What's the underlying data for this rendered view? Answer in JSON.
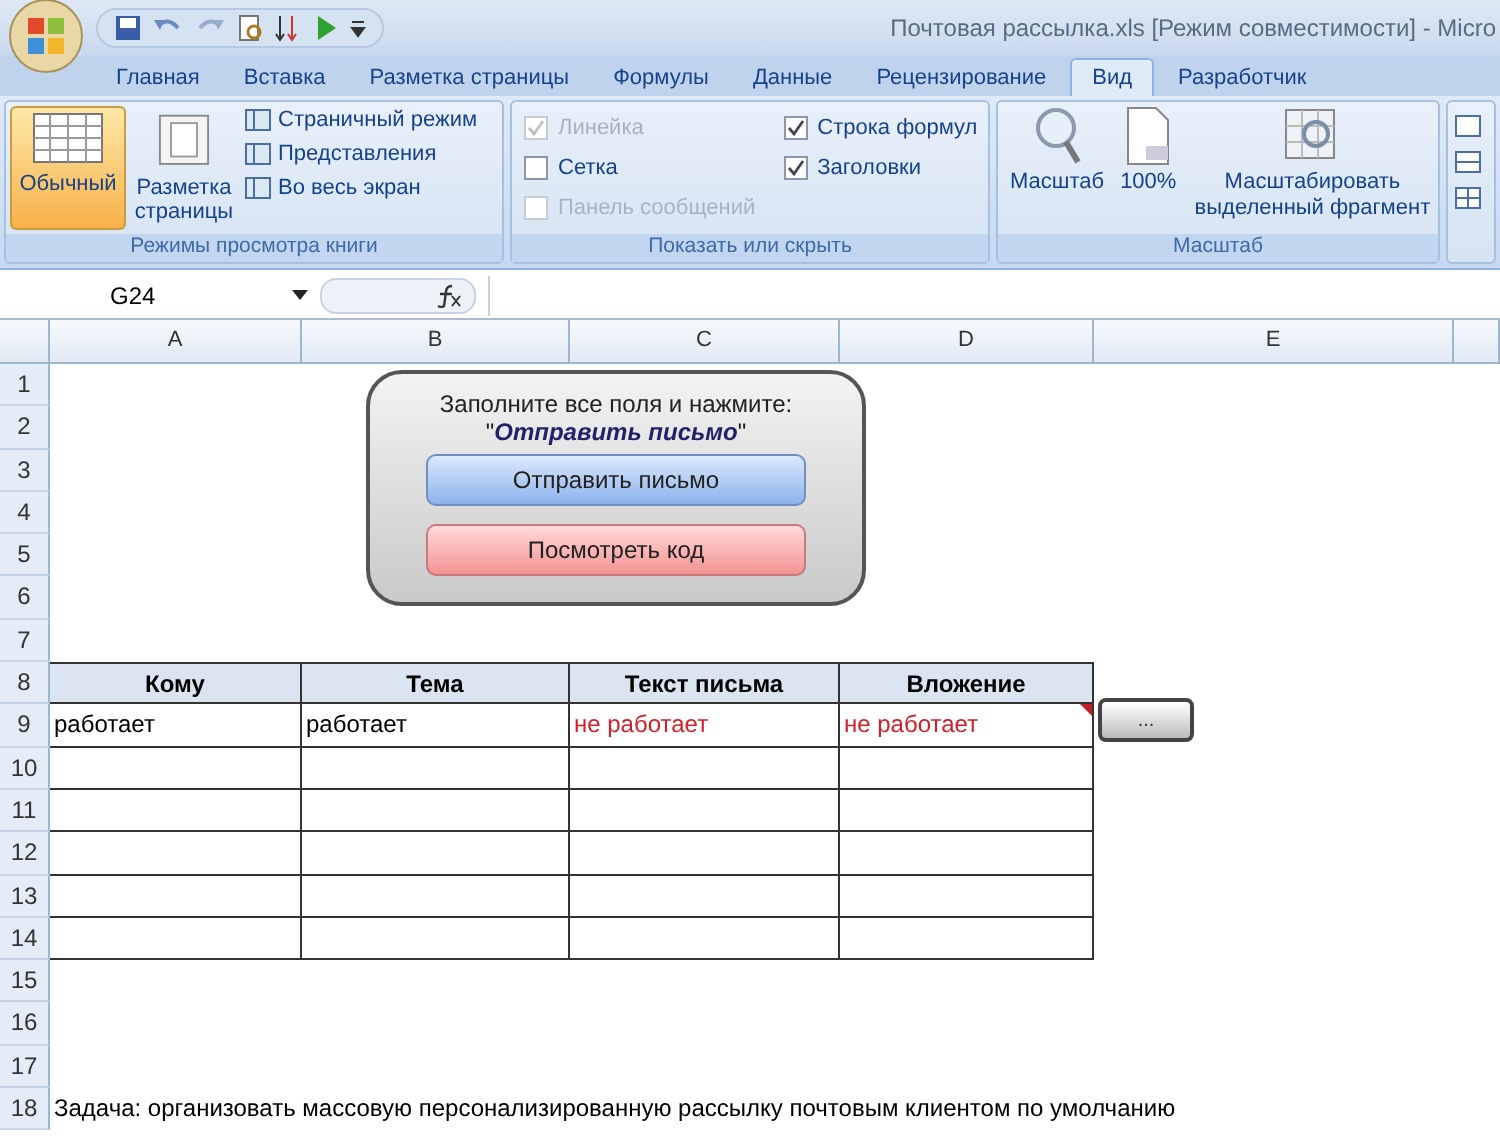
{
  "window": {
    "title": "Почтовая рассылка.xls  [Режим совместимости] - Micro"
  },
  "tabs": [
    {
      "label": "Главная",
      "selected": false
    },
    {
      "label": "Вставка",
      "selected": false
    },
    {
      "label": "Разметка страницы",
      "selected": false
    },
    {
      "label": "Формулы",
      "selected": false
    },
    {
      "label": "Данные",
      "selected": false
    },
    {
      "label": "Рецензирование",
      "selected": false
    },
    {
      "label": "Вид",
      "selected": true
    },
    {
      "label": "Разработчик",
      "selected": false
    }
  ],
  "ribbon": {
    "views": {
      "label": "Режимы просмотра книги",
      "large": [
        {
          "label": "Обычный",
          "selected": true
        },
        {
          "label": "Разметка страницы",
          "selected": false
        }
      ],
      "small": [
        "Страничный режим",
        "Представления",
        "Во весь экран"
      ]
    },
    "show": {
      "label": "Показать или скрыть",
      "checkboxes": [
        {
          "label": "Линейка",
          "checked": true,
          "disabled": true
        },
        {
          "label": "Сетка",
          "checked": false,
          "disabled": false
        },
        {
          "label": "Панель сообщений",
          "checked": false,
          "disabled": true
        },
        {
          "label": "Строка формул",
          "checked": true,
          "disabled": false
        },
        {
          "label": "Заголовки",
          "checked": true,
          "disabled": false
        }
      ]
    },
    "zoom": {
      "label": "Масштаб",
      "buttons": [
        "Масштаб",
        "100%",
        "Масштабировать выделенный фрагмент"
      ]
    }
  },
  "name_box": "G24",
  "sheet": {
    "columns": [
      "A",
      "B",
      "C",
      "D",
      "E"
    ],
    "rows": [
      {
        "number": "1",
        "kind": "blank"
      },
      {
        "number": "2",
        "kind": "blank"
      },
      {
        "number": "3",
        "kind": "blank"
      },
      {
        "number": "4",
        "kind": "blank"
      },
      {
        "number": "5",
        "kind": "blank"
      },
      {
        "number": "6",
        "kind": "blank"
      },
      {
        "number": "7",
        "kind": "blank"
      },
      {
        "number": "8",
        "kind": "header",
        "cells": [
          {
            "text": "Кому"
          },
          {
            "text": "Тема"
          },
          {
            "text": "Текст письма"
          },
          {
            "text": "Вложение"
          }
        ]
      },
      {
        "number": "9",
        "kind": "data",
        "cells": [
          {
            "text": "работает",
            "warning": false,
            "comment": false
          },
          {
            "text": "работает",
            "warning": false,
            "comment": false
          },
          {
            "text": "не работает",
            "warning": true,
            "comment": false
          },
          {
            "text": "не работает",
            "warning": true,
            "comment": true
          }
        ]
      },
      {
        "number": "10",
        "kind": "data"
      },
      {
        "number": "11",
        "kind": "data"
      },
      {
        "number": "12",
        "kind": "data"
      },
      {
        "number": "13",
        "kind": "data"
      },
      {
        "number": "14",
        "kind": "data"
      },
      {
        "number": "15",
        "kind": "blank"
      },
      {
        "number": "16",
        "kind": "blank"
      },
      {
        "number": "17",
        "kind": "blank"
      },
      {
        "number": "18",
        "kind": "note",
        "text": "Задача: организовать массовую персонализированную рассылку почтовым клиентом по умолчанию"
      }
    ],
    "panel": {
      "instruction": "Заполните все поля и нажмите:",
      "quote": "\"*Отправить письмо*\"",
      "send_button": "Отправить письмо",
      "code_button": "Посмотреть код"
    },
    "attach_button": "..."
  }
}
